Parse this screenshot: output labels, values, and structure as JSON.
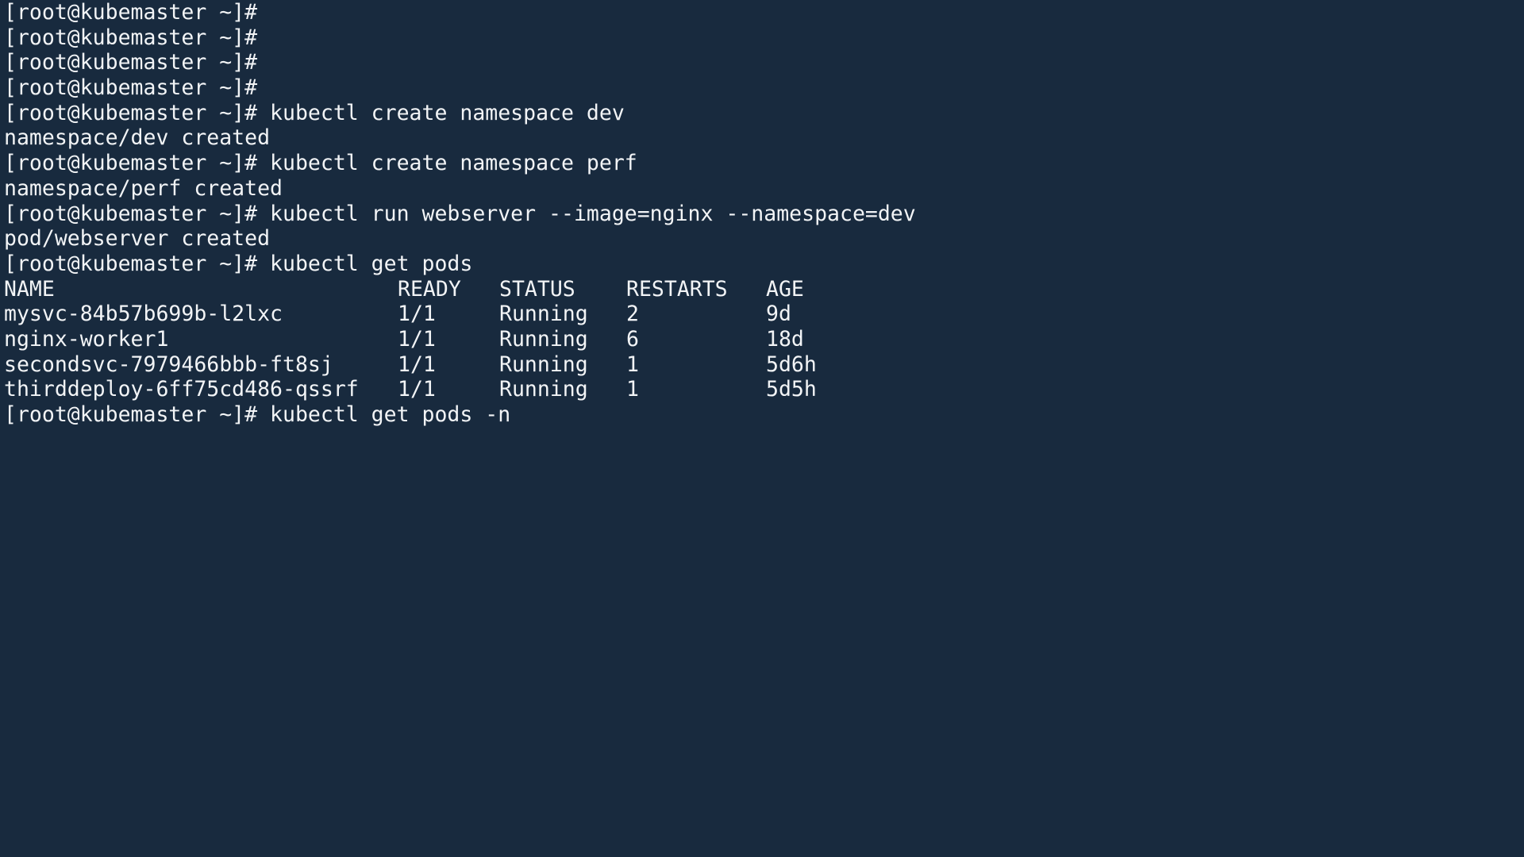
{
  "terminal": {
    "prompt": "[root@kubemaster ~]# ",
    "lines": [
      {
        "type": "prompt",
        "cmd": ""
      },
      {
        "type": "prompt",
        "cmd": ""
      },
      {
        "type": "prompt",
        "cmd": ""
      },
      {
        "type": "prompt",
        "cmd": ""
      },
      {
        "type": "prompt",
        "cmd": "kubectl create namespace dev"
      },
      {
        "type": "output",
        "text": "namespace/dev created"
      },
      {
        "type": "prompt",
        "cmd": "kubectl create namespace perf"
      },
      {
        "type": "output",
        "text": "namespace/perf created"
      },
      {
        "type": "prompt",
        "cmd": "kubectl run webserver --image=nginx --namespace=dev"
      },
      {
        "type": "output",
        "text": "pod/webserver created"
      },
      {
        "type": "prompt",
        "cmd": "kubectl get pods"
      }
    ],
    "pods_table": {
      "headers": [
        "NAME",
        "READY",
        "STATUS",
        "RESTARTS",
        "AGE"
      ],
      "rows": [
        [
          "mysvc-84b57b699b-l2lxc",
          "1/1",
          "Running",
          "2",
          "9d"
        ],
        [
          "nginx-worker1",
          "1/1",
          "Running",
          "6",
          "18d"
        ],
        [
          "secondsvc-7979466bbb-ft8sj",
          "1/1",
          "Running",
          "1",
          "5d6h"
        ],
        [
          "thirddeploy-6ff75cd486-qssrf",
          "1/1",
          "Running",
          "1",
          "5d5h"
        ]
      ]
    },
    "current_prompt": "[root@kubemaster ~]# ",
    "current_input": "kubectl get pods -n"
  },
  "colors": {
    "background": "#182a3e",
    "text": "#f2f4f6"
  }
}
